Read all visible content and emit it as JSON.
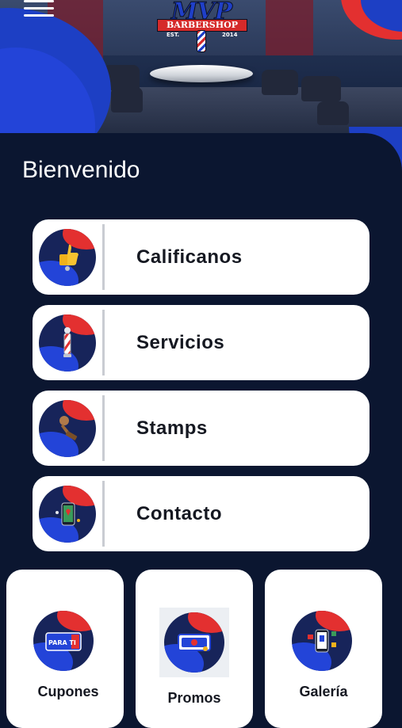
{
  "header": {
    "logo_text": "MVP",
    "logo_subtitle": "BARBERSHOP",
    "logo_est": "EST.",
    "logo_year": "2014"
  },
  "welcome_title": "Bienvenido",
  "menu_items": [
    {
      "label": "Calificanos",
      "icon": "thumbs-up-icon"
    },
    {
      "label": "Servicios",
      "icon": "barber-pole-icon"
    },
    {
      "label": "Stamps",
      "icon": "stamp-icon"
    },
    {
      "label": "Contacto",
      "icon": "phone-map-icon"
    }
  ],
  "grid_items": [
    {
      "label": "Cupones",
      "icon": "coupon-icon",
      "badge": "PARA TI"
    },
    {
      "label": "Promos",
      "icon": "promo-ticket-icon"
    },
    {
      "label": "Galería",
      "icon": "gallery-phone-icon"
    }
  ],
  "colors": {
    "background": "#0b1630",
    "accent_blue": "#2344d8",
    "accent_red": "#e33030",
    "card": "#ffffff"
  }
}
